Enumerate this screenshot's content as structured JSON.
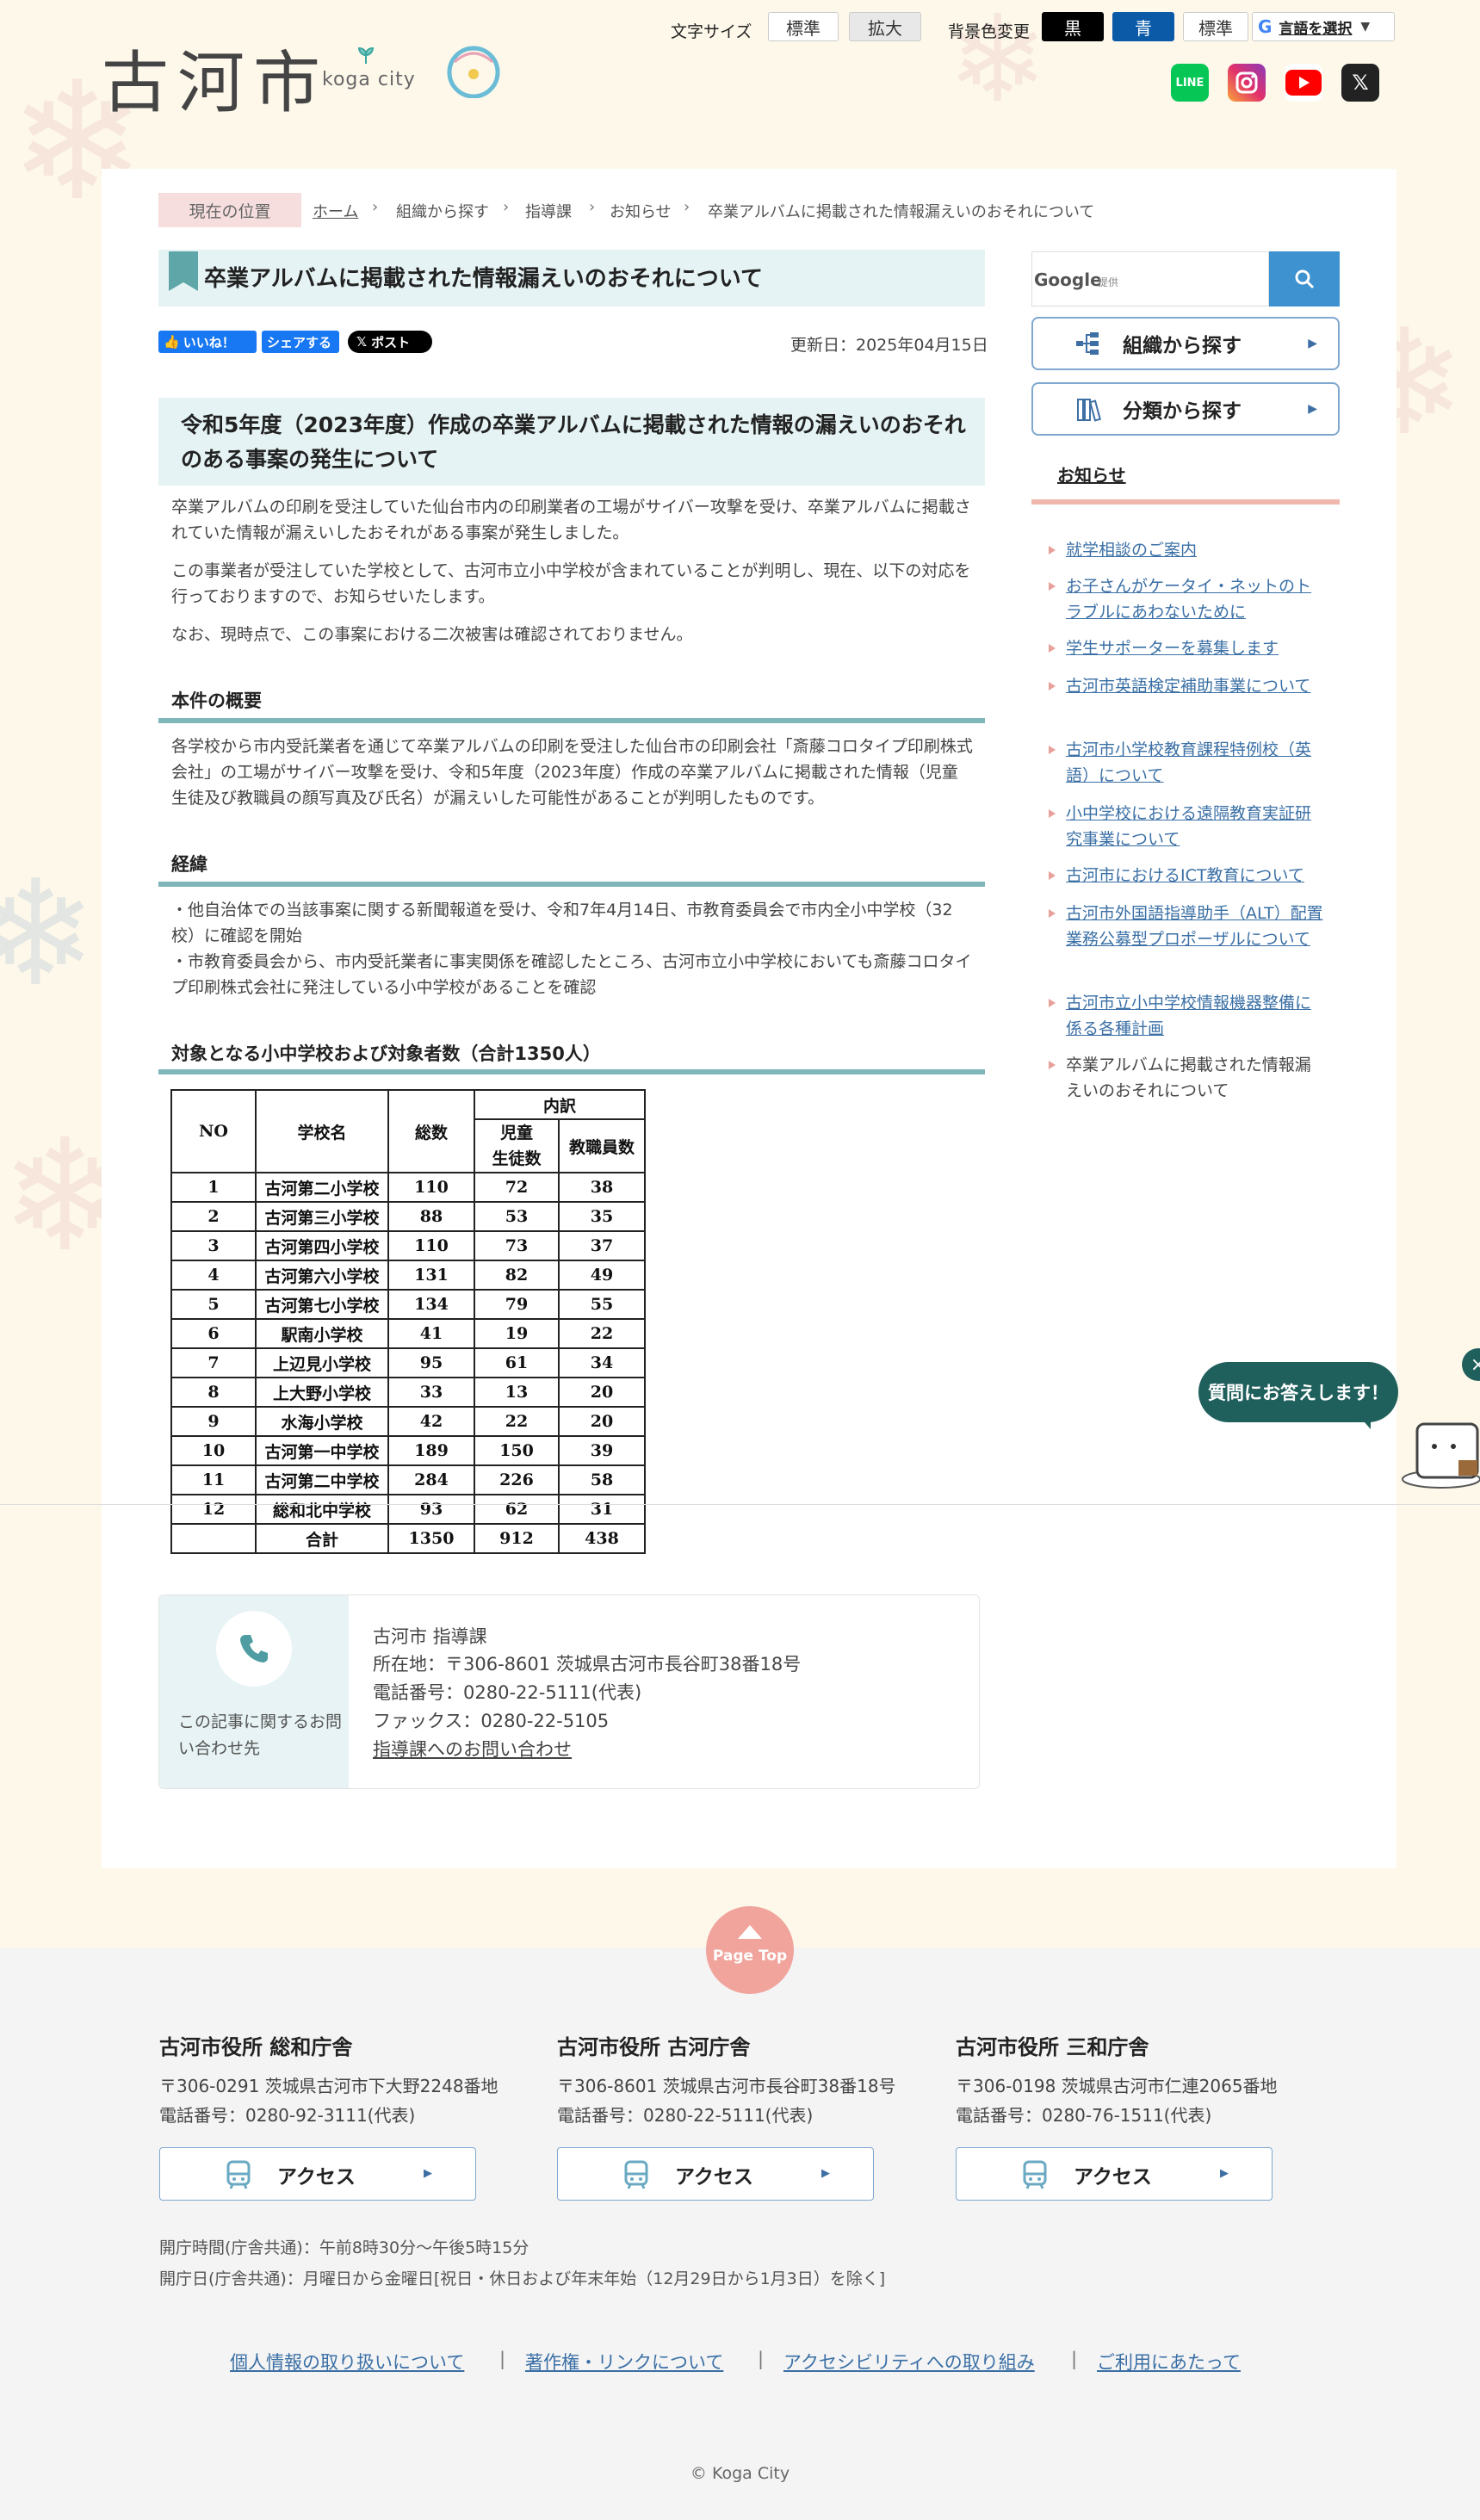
{
  "header": {
    "logo_text": "古河市",
    "logo_sub": "koga city",
    "font_size_label": "文字サイズ",
    "font_standard": "標準",
    "font_large": "拡大",
    "bg_color_label": "背景色変更",
    "bg_black": "黒",
    "bg_blue": "青",
    "bg_standard": "標準",
    "language_select": "言語を選択",
    "social": [
      "line-icon",
      "instagram-icon",
      "youtube-icon",
      "x-icon"
    ]
  },
  "breadcrumb": {
    "label": "現在の位置",
    "items": [
      "ホーム",
      "組織から探す",
      "指導課",
      "お知らせ",
      "卒業アルバムに掲載された情報漏えいのおそれについて"
    ]
  },
  "article": {
    "title": "卒業アルバムに掲載された情報漏えいのおそれについて",
    "like_label": "いいね！",
    "share_label": "シェアする",
    "post_label": "ポスト",
    "updated": "更新日：2025年04月15日",
    "heading": "令和5年度（2023年度）作成の卒業アルバムに掲載された情報の漏えいのおそれのある事案の発生について",
    "intro": [
      "卒業アルバムの印刷を受注していた仙台市内の印刷業者の工場がサイバー攻撃を受け、卒業アルバムに掲載されていた情報が漏えいしたおそれがある事案が発生しました。",
      "この事業者が受注していた学校として、古河市立小中学校が含まれていることが判明し、現在、以下の対応を行っておりますので、お知らせいたします。",
      "なお、現時点で、この事案における二次被害は確認されておりません。"
    ],
    "overview_title": "本件の概要",
    "overview_text": "各学校から市内受託業者を通じて卒業アルバムの印刷を受注した仙台市の印刷会社「斎藤コロタイプ印刷株式会社」の工場がサイバー攻撃を受け、令和5年度（2023年度）作成の卒業アルバムに掲載された情報（児童生徒及び教職員の顔写真及び氏名）が漏えいした可能性があることが判明したものです。",
    "history_title": "経緯",
    "history_items": [
      "・他自治体での当該事案に関する新聞報道を受け、令和7年4月14日、市教育委員会で市内全小中学校（32校）に確認を開始",
      "・市教育委員会から、市内受託業者に事実関係を確認したところ、古河市立小中学校においても斎藤コロタイプ印刷株式会社に発注している小中学校があることを確認"
    ],
    "table_title": "対象となる小中学校および対象者数（合計1350人）",
    "table": {
      "headers": {
        "no": "NO",
        "school": "学校名",
        "total": "総数",
        "breakdown": "内訳",
        "students_1": "児童",
        "students_2": "生徒数",
        "staff": "教職員数"
      },
      "rows": [
        [
          "1",
          "古河第二小学校",
          "110",
          "72",
          "38"
        ],
        [
          "2",
          "古河第三小学校",
          "88",
          "53",
          "35"
        ],
        [
          "3",
          "古河第四小学校",
          "110",
          "73",
          "37"
        ],
        [
          "4",
          "古河第六小学校",
          "131",
          "82",
          "49"
        ],
        [
          "5",
          "古河第七小学校",
          "134",
          "79",
          "55"
        ],
        [
          "6",
          "駅南小学校",
          "41",
          "19",
          "22"
        ],
        [
          "7",
          "上辺見小学校",
          "95",
          "61",
          "34"
        ],
        [
          "8",
          "上大野小学校",
          "33",
          "13",
          "20"
        ],
        [
          "9",
          "水海小学校",
          "42",
          "22",
          "20"
        ],
        [
          "10",
          "古河第一中学校",
          "189",
          "150",
          "39"
        ],
        [
          "11",
          "古河第二中学校",
          "284",
          "226",
          "58"
        ],
        [
          "12",
          "総和北中学校",
          "93",
          "62",
          "31"
        ]
      ],
      "total_row": [
        "",
        "合計",
        "1350",
        "912",
        "438"
      ]
    }
  },
  "contact": {
    "caption": "この記事に関するお問い合わせ先",
    "dept": "古河市 指導課",
    "address": "所在地：〒306-8601 茨城県古河市長谷町38番18号",
    "tel": "電話番号：0280-22-5111(代表)",
    "fax": "ファックス：0280-22-5105",
    "form_link": "指導課へのお問い合わせ"
  },
  "sidebar": {
    "search_provider": "Google",
    "search_provider_sub": "提供",
    "org_button": "組織から探す",
    "category_button": "分類から探す",
    "news_heading": "お知らせ",
    "news_items": [
      "就学相談のご案内",
      "お子さんがケータイ・ネットのトラブルにあわないために",
      "学生サポーターを募集します",
      "古河市英語検定補助事業について",
      "古河市小学校教育課程特例校（英語）について",
      "小中学校における遠隔教育実証研究事業について",
      "古河市におけるICT教育について",
      "古河市外国語指導助手（ALT）配置業務公募型プロポーザルについて",
      "古河市立小中学校情報機器整備に係る各種計画",
      "卒業アルバムに掲載された情報漏えいのおそれについて"
    ]
  },
  "chat": {
    "label": "質問にお答えします！",
    "close": "×"
  },
  "footer": {
    "page_top": "Page Top",
    "offices": [
      {
        "name": "古河市役所 総和庁舎",
        "address": "〒306-0291 茨城県古河市下大野2248番地",
        "tel": "電話番号：0280-92-3111(代表)",
        "access": "アクセス"
      },
      {
        "name": "古河市役所 古河庁舎",
        "address": "〒306-8601 茨城県古河市長谷町38番18号",
        "tel": "電話番号：0280-22-5111(代表)",
        "access": "アクセス"
      },
      {
        "name": "古河市役所 三和庁舎",
        "address": "〒306-0198 茨城県古河市仁連2065番地",
        "tel": "電話番号：0280-76-1511(代表)",
        "access": "アクセス"
      }
    ],
    "hours": "開庁時間(庁舎共通)：午前8時30分～午後5時15分",
    "days": "開庁日(庁舎共通)：月曜日から金曜日[祝日・休日および年末年始（12月29日から1月3日）を除く]",
    "links": [
      "個人情報の取り扱いについて",
      "著作権・リンクについて",
      "アクセシビリティへの取り組み",
      "ご利用にあたって"
    ],
    "copyright": "© Koga City"
  }
}
